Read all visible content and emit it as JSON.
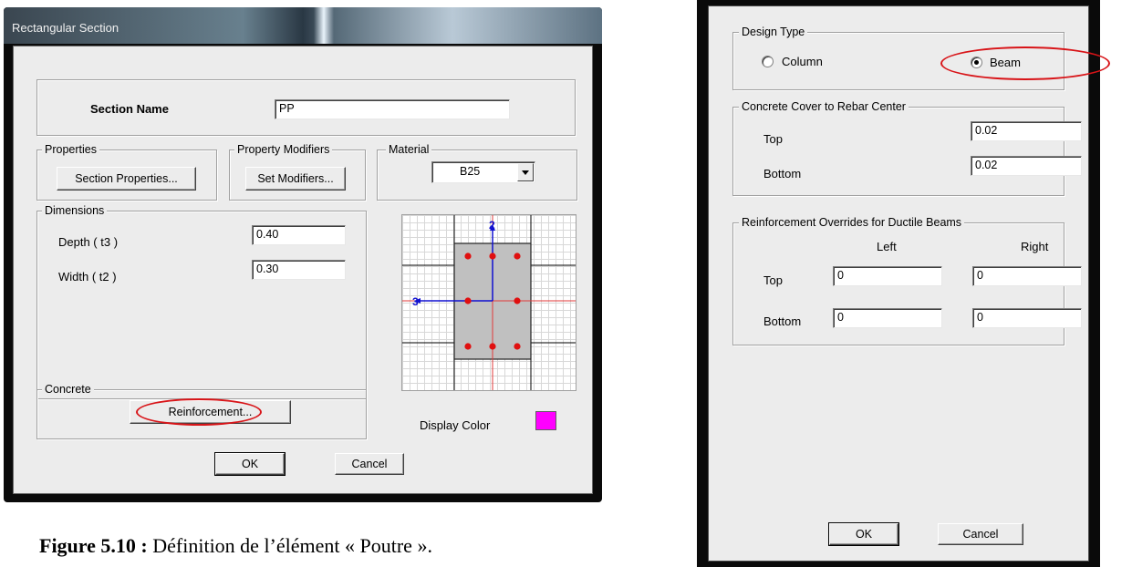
{
  "left_dialog": {
    "title": "Rectangular Section",
    "section_name_label": "Section Name",
    "section_name_value": "PP",
    "properties_group": "Properties",
    "section_properties_button": "Section Properties...",
    "modifiers_group": "Property Modifiers",
    "set_modifiers_button": "Set Modifiers...",
    "material_group": "Material",
    "material_value": "B25",
    "dimensions_group": "Dimensions",
    "depth_label": "Depth  ( t3 )",
    "depth_value": "0.40",
    "width_label": "Width  ( t2 )",
    "width_value": "0.30",
    "axis_2_label": "2",
    "axis_3_label": "3",
    "concrete_group": "Concrete",
    "reinforcement_button": "Reinforcement...",
    "display_color_label": "Display Color",
    "display_color": "#ff00ff",
    "ok_button": "OK",
    "cancel_button": "Cancel"
  },
  "caption": {
    "bold": "Figure 5.10 :",
    "text": " Définition de l’élément « Poutre »."
  },
  "right_dialog": {
    "design_type_group": "Design Type",
    "column_option": "Column",
    "beam_option": "Beam",
    "selected_design_type": "Beam",
    "cover_group": "Concrete Cover to Rebar Center",
    "cover_top_label": "Top",
    "cover_top_value": "0.02",
    "cover_bottom_label": "Bottom",
    "cover_bottom_value": "0.02",
    "overrides_group": "Reinforcement Overrides for Ductile Beams",
    "left_header": "Left",
    "right_header": "Right",
    "top_label": "Top",
    "bottom_label": "Bottom",
    "top_left_value": "0",
    "top_right_value": "0",
    "bottom_left_value": "0",
    "bottom_right_value": "0",
    "ok_button": "OK",
    "cancel_button": "Cancel"
  },
  "highlight_color": "#d81418"
}
